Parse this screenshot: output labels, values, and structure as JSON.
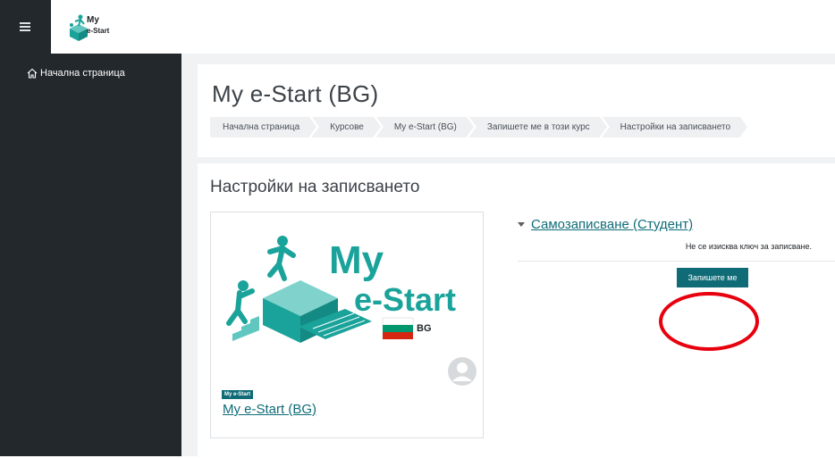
{
  "navbar": {
    "logo_text_top": "My",
    "logo_text_bottom": "e-Start"
  },
  "sidebar": {
    "items": [
      {
        "label": "Начална страница",
        "icon": "home-icon"
      }
    ]
  },
  "page": {
    "title": "My e-Start (BG)"
  },
  "breadcrumb": [
    "Начална страница",
    "Курсове",
    "My e-Start (BG)",
    "Запишете ме в този курс",
    "Настройки на записването"
  ],
  "content": {
    "section_title": "Настройки на записването",
    "course": {
      "image_text_top": "My",
      "image_text_bottom": "e-Start",
      "flag_label": "BG",
      "category": "My e-Start",
      "name": "My e-Start (BG)"
    },
    "enrolment": {
      "method": "Самозаписване (Студент)",
      "note": "Не се изисква ключ за записване.",
      "button_label": "Запишете ме"
    }
  },
  "colors": {
    "accent": "#0f6c77",
    "sidebar": "#23282d",
    "annotation": "#e8000e",
    "logo_teal": "#1aa39a"
  }
}
